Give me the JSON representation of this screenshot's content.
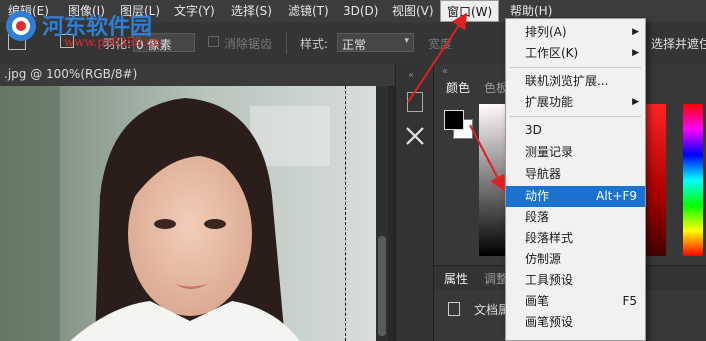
{
  "menubar": {
    "items": [
      "编辑(E)",
      "图像(I)",
      "图层(L)",
      "文字(Y)",
      "选择(S)",
      "滤镜(T)",
      "3D(D)",
      "视图(V)",
      "窗口(W)",
      "帮助(H)"
    ]
  },
  "watermark": {
    "title": "河东软件园",
    "url": "www.pc0359.cn"
  },
  "options": {
    "feather_label": "羽化:",
    "feather_value": "0 像素",
    "antialias_label": "消除锯齿",
    "style_label": "样式:",
    "style_value": "正常",
    "width_label": "宽度",
    "select_mask_label": "选择并遮住"
  },
  "document": {
    "tab_title": ".jpg @ 100%(RGB/8#)"
  },
  "panels": {
    "color_tab": "颜色",
    "swatches_tab": "色板",
    "properties_tab": "属性",
    "adjustments_tab": "调整",
    "doc_label": "文档属"
  },
  "window_menu": {
    "items": [
      {
        "label": "排列(A)",
        "shortcut": "",
        "submenu": true
      },
      {
        "label": "工作区(K)",
        "shortcut": "",
        "submenu": true
      },
      {
        "label": "联机浏览扩展...",
        "shortcut": "",
        "submenu": false
      },
      {
        "label": "扩展功能",
        "shortcut": "",
        "submenu": true
      },
      {
        "label": "3D",
        "shortcut": "",
        "submenu": false
      },
      {
        "label": "测量记录",
        "shortcut": "",
        "submenu": false
      },
      {
        "label": "导航器",
        "shortcut": "",
        "submenu": false
      },
      {
        "label": "动作",
        "shortcut": "Alt+F9",
        "submenu": false
      },
      {
        "label": "段落",
        "shortcut": "",
        "submenu": false
      },
      {
        "label": "段落样式",
        "shortcut": "",
        "submenu": false
      },
      {
        "label": "仿制源",
        "shortcut": "",
        "submenu": false
      },
      {
        "label": "工具预设",
        "shortcut": "",
        "submenu": false
      },
      {
        "label": "画笔",
        "shortcut": "F5",
        "submenu": false
      },
      {
        "label": "画笔预设",
        "shortcut": "",
        "submenu": false
      }
    ],
    "highlighted": "动作"
  },
  "colors": {
    "highlight": "#1a73d0",
    "arrow": "#e02020",
    "watermark_blue": "#2f7fd6",
    "watermark_red": "#e02c2c"
  }
}
